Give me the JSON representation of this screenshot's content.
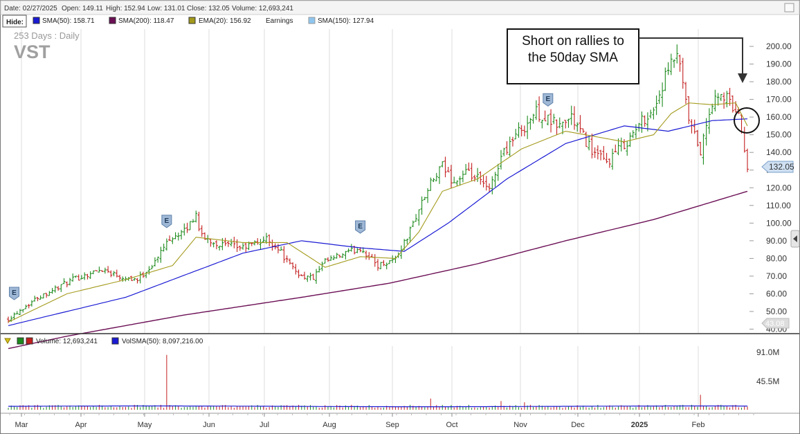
{
  "header": {
    "date_text": "Date: 02/27/2025",
    "open_text": "Open: 149.11",
    "high_text": "High: 152.94",
    "low_text": "Low: 131.01",
    "close_text": "Close: 132.05",
    "volume_text": "Volume: 12,693,241"
  },
  "legend": {
    "hide_label": "Hide:",
    "sma50": "SMA(50): 158.71",
    "sma200": "SMA(200): 118.47",
    "ema20": "EMA(20): 156.92",
    "earnings": "Earnings",
    "sma150": "SMA(150): 127.94"
  },
  "colors": {
    "sma50": "#1a1ad4",
    "sma200": "#6b0f55",
    "ema20": "#a39a1c",
    "sma150": "#8ec5ee",
    "up": "#1c8a1c",
    "down": "#c41e1e",
    "earnings_badge": "#9fb8d6"
  },
  "chart_info": {
    "period": "253  Days : Daily",
    "symbol": "VST",
    "close_tag": "132.05",
    "low_tag": "43.08",
    "earnings_marker": "E"
  },
  "annotation": {
    "line1": "Short on rallies to",
    "line2": "the 50day SMA"
  },
  "volume_legend": {
    "volume": "Volume: 12,693,241",
    "volsma": "VolSMA(50): 8,097,216.00"
  },
  "volume_axis": [
    "91.0M",
    "45.5M"
  ],
  "chart_data": {
    "type": "ohlc",
    "symbol": "VST",
    "ylim": [
      40,
      200
    ],
    "yticks": [
      "200.00",
      "190.00",
      "180.00",
      "170.00",
      "160.00",
      "150.00",
      "140.00",
      "130.00",
      "120.00",
      "110.00",
      "100.00",
      "90.00",
      "80.00",
      "70.00",
      "60.00",
      "50.00",
      "40.00"
    ],
    "xticks": [
      "Mar",
      "Apr",
      "May",
      "Jun",
      "Jul",
      "Aug",
      "Sep",
      "Oct",
      "Nov",
      "Dec",
      "2025",
      "Feb"
    ],
    "price_path": [
      [
        0,
        46
      ],
      [
        10,
        58
      ],
      [
        22,
        68
      ],
      [
        32,
        74
      ],
      [
        38,
        70
      ],
      [
        44,
        68
      ],
      [
        50,
        78
      ],
      [
        55,
        92
      ],
      [
        60,
        95
      ],
      [
        64,
        105
      ],
      [
        66,
        92
      ],
      [
        72,
        88
      ],
      [
        80,
        86
      ],
      [
        88,
        91
      ],
      [
        92,
        86
      ],
      [
        96,
        76
      ],
      [
        100,
        70
      ],
      [
        104,
        69
      ],
      [
        108,
        78
      ],
      [
        114,
        82
      ],
      [
        120,
        86
      ],
      [
        126,
        76
      ],
      [
        132,
        80
      ],
      [
        136,
        92
      ],
      [
        140,
        108
      ],
      [
        144,
        122
      ],
      [
        148,
        132
      ],
      [
        152,
        123
      ],
      [
        156,
        128
      ],
      [
        160,
        125
      ],
      [
        164,
        118
      ],
      [
        168,
        138
      ],
      [
        172,
        148
      ],
      [
        176,
        155
      ],
      [
        180,
        163
      ],
      [
        184,
        158
      ],
      [
        188,
        155
      ],
      [
        192,
        160
      ],
      [
        196,
        149
      ],
      [
        200,
        139
      ],
      [
        204,
        134
      ],
      [
        208,
        142
      ],
      [
        212,
        148
      ],
      [
        216,
        158
      ],
      [
        220,
        164
      ],
      [
        224,
        182
      ],
      [
        228,
        196
      ],
      [
        232,
        158
      ],
      [
        236,
        140
      ],
      [
        240,
        168
      ],
      [
        244,
        172
      ],
      [
        248,
        164
      ],
      [
        250,
        155
      ],
      [
        252,
        132
      ]
    ],
    "series": [
      {
        "name": "SMA(50)",
        "points": [
          [
            0,
            42
          ],
          [
            40,
            58
          ],
          [
            80,
            83
          ],
          [
            100,
            90
          ],
          [
            120,
            86
          ],
          [
            135,
            84
          ],
          [
            150,
            100
          ],
          [
            170,
            125
          ],
          [
            190,
            145
          ],
          [
            210,
            155
          ],
          [
            225,
            152
          ],
          [
            240,
            158
          ],
          [
            252,
            159
          ]
        ]
      },
      {
        "name": "SMA(200)",
        "points": [
          [
            0,
            29
          ],
          [
            20,
            36
          ],
          [
            60,
            48
          ],
          [
            100,
            58
          ],
          [
            130,
            66
          ],
          [
            160,
            77
          ],
          [
            190,
            90
          ],
          [
            220,
            102
          ],
          [
            240,
            112
          ],
          [
            252,
            118
          ]
        ]
      },
      {
        "name": "EMA(20)",
        "points": [
          [
            0,
            44
          ],
          [
            20,
            60
          ],
          [
            40,
            68
          ],
          [
            56,
            76
          ],
          [
            64,
            92
          ],
          [
            80,
            89
          ],
          [
            95,
            89
          ],
          [
            108,
            75
          ],
          [
            120,
            81
          ],
          [
            132,
            80
          ],
          [
            140,
            95
          ],
          [
            148,
            118
          ],
          [
            160,
            125
          ],
          [
            175,
            142
          ],
          [
            190,
            152
          ],
          [
            210,
            146
          ],
          [
            220,
            150
          ],
          [
            226,
            162
          ],
          [
            232,
            168
          ],
          [
            240,
            167
          ],
          [
            248,
            168
          ],
          [
            252,
            155
          ]
        ]
      }
    ],
    "volume_ylim": [
      0,
      91
    ],
    "volume_spikes": [
      [
        54,
        88
      ],
      [
        236,
        24
      ],
      [
        144,
        18
      ],
      [
        168,
        14
      ],
      [
        176,
        12
      ]
    ],
    "earnings_days": [
      2,
      54,
      120,
      184
    ]
  }
}
